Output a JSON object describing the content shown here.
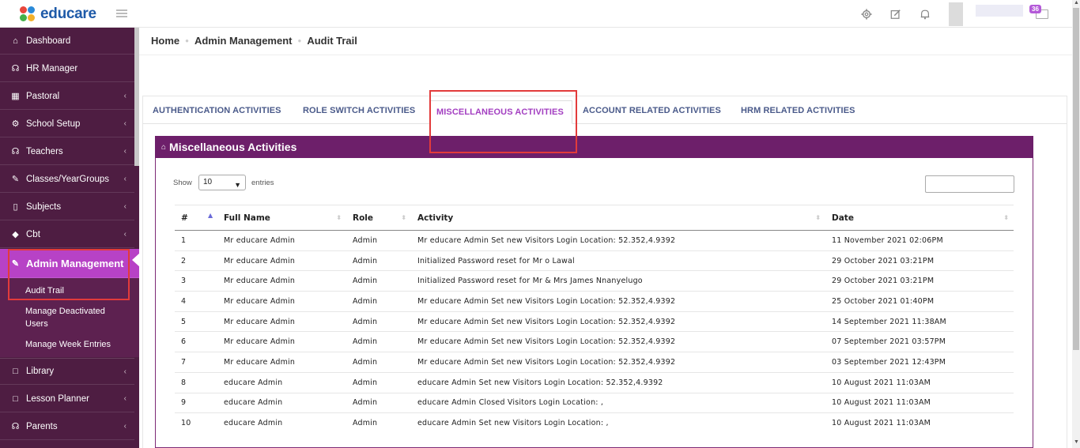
{
  "header": {
    "logo_text": "educare",
    "notification_count": "36",
    "icons": [
      "gear-icon",
      "edit-icon",
      "bell-icon",
      "mail-icon"
    ]
  },
  "sidebar": {
    "items": [
      {
        "label": "Dashboard",
        "icon": "home-icon",
        "has_chevron": false
      },
      {
        "label": "HR Manager",
        "icon": "users-icon",
        "has_chevron": false
      },
      {
        "label": "Pastoral",
        "icon": "table-icon",
        "has_chevron": true
      },
      {
        "label": "School Setup",
        "icon": "gear-icon",
        "has_chevron": true
      },
      {
        "label": "Teachers",
        "icon": "users-icon",
        "has_chevron": true
      },
      {
        "label": "Classes/YearGroups",
        "icon": "edit-icon",
        "has_chevron": true
      },
      {
        "label": "Subjects",
        "icon": "book-icon",
        "has_chevron": true
      },
      {
        "label": "Cbt",
        "icon": "graduation-cap-icon",
        "has_chevron": true
      },
      {
        "label": "Admin Management",
        "icon": "wrench-icon",
        "has_chevron": false
      },
      {
        "label": "Library",
        "icon": "square-icon",
        "has_chevron": true
      },
      {
        "label": "Lesson Planner",
        "icon": "square-icon",
        "has_chevron": true
      },
      {
        "label": "Parents",
        "icon": "user-icon",
        "has_chevron": true
      }
    ],
    "submenu": [
      "Audit Trail",
      "Manage Deactivated Users",
      "Manage Week Entries"
    ],
    "chevron": "‹"
  },
  "breadcrumb": [
    "Home",
    "Admin Management",
    "Audit Trail"
  ],
  "tabs": [
    "AUTHENTICATION ACTIVITIES",
    "ROLE SWITCH ACTIVITIES",
    "MISCELLANEOUS ACTIVITIES",
    "ACCOUNT RELATED ACTIVITIES",
    "HRM RELATED ACTIVITIES"
  ],
  "active_tab": "MISCELLANEOUS ACTIVITIES",
  "panel": {
    "title": "Miscellaneous Activities",
    "show_label": "Show",
    "entries_value": "10",
    "entries_label": "entries",
    "search_value": ""
  },
  "table": {
    "columns": [
      "#",
      "Full Name",
      "Role",
      "Activity",
      "Date"
    ],
    "rows": [
      [
        "1",
        "Mr educare Admin",
        "Admin",
        "Mr educare Admin Set new Visitors Login Location: 52.352,4.9392",
        "11 November 2021 02:06PM"
      ],
      [
        "2",
        "Mr educare Admin",
        "Admin",
        "Initialized Password reset for Mr o Lawal",
        "29 October 2021 03:21PM"
      ],
      [
        "3",
        "Mr educare Admin",
        "Admin",
        "Initialized Password reset for Mr & Mrs James Nnanyelugo",
        "29 October 2021 03:21PM"
      ],
      [
        "4",
        "Mr educare Admin",
        "Admin",
        "Mr educare Admin Set new Visitors Login Location: 52.352,4.9392",
        "25 October 2021 01:40PM"
      ],
      [
        "5",
        "Mr educare Admin",
        "Admin",
        "Mr educare Admin Set new Visitors Login Location: 52.352,4.9392",
        "14 September 2021 11:38AM"
      ],
      [
        "6",
        "Mr educare Admin",
        "Admin",
        "Mr educare Admin Set new Visitors Login Location: 52.352,4.9392",
        "07 September 2021 03:57PM"
      ],
      [
        "7",
        "Mr educare Admin",
        "Admin",
        "Mr educare Admin Set new Visitors Login Location: 52.352,4.9392",
        "03 September 2021 12:43PM"
      ],
      [
        "8",
        "educare Admin",
        "Admin",
        "educare Admin Set new Visitors Login Location: 52.352,4.9392",
        "10 August 2021 11:03AM"
      ],
      [
        "9",
        "educare Admin",
        "Admin",
        "educare Admin Closed Visitors Login Location: ,",
        "10 August 2021 11:03AM"
      ],
      [
        "10",
        "educare Admin",
        "Admin",
        "educare Admin Set new Visitors Login Location: ,",
        "10 August 2021 11:03AM"
      ]
    ]
  },
  "colors": {
    "sidebar_bg": "#4e1d42",
    "sidebar_active": "#b742c6",
    "panel_header": "#6d1f6a",
    "tab_text": "#4a5a8a",
    "tab_active_text": "#a33fc1",
    "highlight_box": "#e23b3b",
    "logo": "#1e5aa8"
  }
}
